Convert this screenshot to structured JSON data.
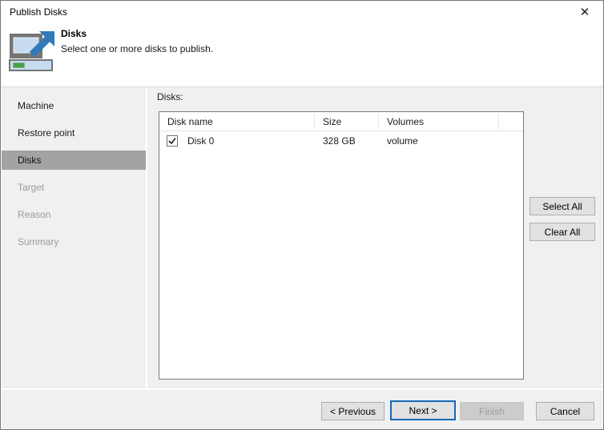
{
  "window": {
    "title": "Publish Disks",
    "close_icon": "✕"
  },
  "header": {
    "title": "Disks",
    "subtitle": "Select one or more disks to publish."
  },
  "sidebar": {
    "items": [
      {
        "label": "Machine",
        "state": "done"
      },
      {
        "label": "Restore point",
        "state": "done"
      },
      {
        "label": "Disks",
        "state": "active"
      },
      {
        "label": "Target",
        "state": "upcoming"
      },
      {
        "label": "Reason",
        "state": "upcoming"
      },
      {
        "label": "Summary",
        "state": "upcoming"
      }
    ]
  },
  "main": {
    "disks_label": "Disks:",
    "table": {
      "columns": [
        "Disk name",
        "Size",
        "Volumes"
      ],
      "rows": [
        {
          "checked": true,
          "disk_name": "Disk 0",
          "size": "328 GB",
          "volumes": "volume"
        }
      ]
    },
    "select_all_label": "Select All",
    "clear_all_label": "Clear All"
  },
  "footer": {
    "previous_label": "< Previous",
    "next_label": "Next >",
    "finish_label": "Finish",
    "cancel_label": "Cancel"
  },
  "colors": {
    "accent_focus_border": "#1569b6",
    "sidebar_selected": "#a3a3a3",
    "icon_arrow_blue": "#3279b7",
    "icon_screen_blue": "#c7dcf0",
    "icon_status_green": "#4aa546",
    "dialog_body": "#f0f0f0",
    "button_face": "#e1e1e1"
  }
}
